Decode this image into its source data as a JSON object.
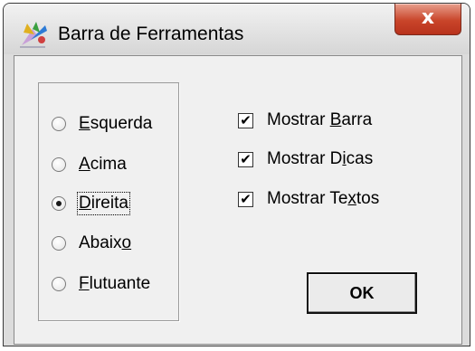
{
  "window": {
    "title": "Barra de Ferramentas",
    "close_glyph": "x"
  },
  "position_group": {
    "options": [
      {
        "pre": "",
        "mnemonic": "E",
        "post": "squerda",
        "checked": false
      },
      {
        "pre": "",
        "mnemonic": "A",
        "post": "cima",
        "checked": false
      },
      {
        "pre": "",
        "mnemonic": "D",
        "post": "ireita",
        "checked": true
      },
      {
        "pre": "Abaix",
        "mnemonic": "o",
        "post": "",
        "checked": false
      },
      {
        "pre": "",
        "mnemonic": "F",
        "post": "lutuante",
        "checked": false
      }
    ]
  },
  "checkboxes": [
    {
      "pre": "Mostrar ",
      "mnemonic": "B",
      "post": "arra",
      "checked": true,
      "mark": "✔"
    },
    {
      "pre": "Mostrar D",
      "mnemonic": "i",
      "post": "cas",
      "checked": true,
      "mark": "✔"
    },
    {
      "pre": "Mostrar Te",
      "mnemonic": "x",
      "post": "tos",
      "checked": true,
      "mark": "✔"
    }
  ],
  "ok_label": "OK",
  "colors": {
    "close_button": "#c9452a",
    "dialog_bg": "#f0f0f0"
  }
}
